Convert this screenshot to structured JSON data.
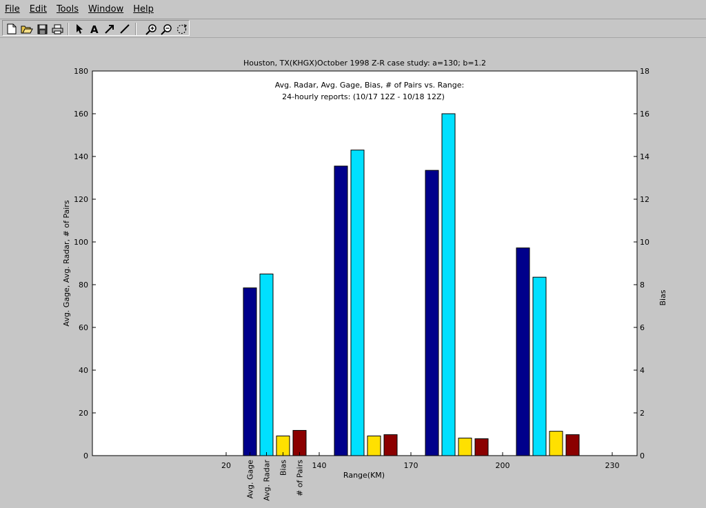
{
  "menu": {
    "file": "File",
    "edit": "Edit",
    "tools": "Tools",
    "window": "Window",
    "help": "Help"
  },
  "toolbar": {
    "items": [
      "new-file-icon",
      "open-file-icon",
      "save-icon",
      "print-icon",
      "pointer-icon",
      "text-icon",
      "arrow-icon",
      "line-icon",
      "zoom-in-icon",
      "zoom-out-icon",
      "rotate-icon"
    ]
  },
  "colors": {
    "avg_gage": "#00008b",
    "avg_radar": "#00e0ff",
    "bias": "#ffe000",
    "num_pairs": "#8b0000"
  },
  "chart_data": {
    "type": "bar",
    "title": "Houston, TX(KHGX)October 1998 Z-R case study: a=130; b=1.2",
    "subtitle_line1": "Avg. Radar, Avg. Gage, Bias, # of Pairs vs. Range:",
    "subtitle_line2": "24-hourly reports: (10/17 12Z - 10/18 12Z)",
    "xlabel": "Range(KM)",
    "ylabel": "Avg. Gage, Avg. Radar, # of Pairs",
    "ylabel_right": "Bias",
    "ylim": [
      0,
      180
    ],
    "ylim_right": [
      0,
      18
    ],
    "yticks": [
      0,
      20,
      40,
      60,
      80,
      100,
      120,
      140,
      160,
      180
    ],
    "yticks_right": [
      0,
      2,
      4,
      6,
      8,
      10,
      12,
      14,
      16,
      18
    ],
    "grid": false,
    "range_tick_labels": [
      "20",
      "140",
      "170",
      "200",
      "230"
    ],
    "series_labels": [
      "Avg. Gage",
      "Avg. Radar",
      "Bias",
      "# of Pairs"
    ],
    "groups": [
      {
        "avg_gage": 78.5,
        "avg_radar": 85,
        "bias": 0.92,
        "num_pairs": 11.8
      },
      {
        "avg_gage": 135.5,
        "avg_radar": 143,
        "bias": 0.92,
        "num_pairs": 9.8
      },
      {
        "avg_gage": 133.5,
        "avg_radar": 160,
        "bias": 0.82,
        "num_pairs": 7.9
      },
      {
        "avg_gage": 97.2,
        "avg_radar": 83.5,
        "bias": 1.14,
        "num_pairs": 9.8
      }
    ]
  }
}
